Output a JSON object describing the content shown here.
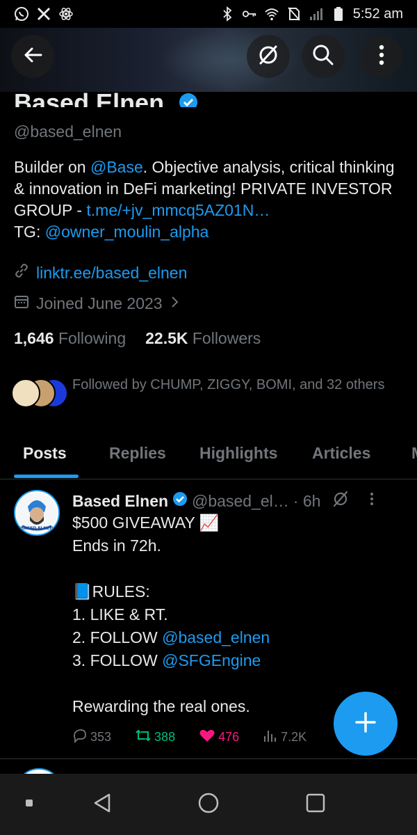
{
  "status_bar": {
    "time": "5:52 am",
    "left_icons": [
      "whatsapp-icon",
      "x-logo-icon",
      "atom-icon"
    ],
    "right_icons": [
      "bluetooth-icon",
      "key-icon",
      "wifi-icon",
      "no-sim-icon",
      "signal-icon",
      "battery-icon"
    ]
  },
  "header": {
    "back_icon": "arrow-left-icon",
    "grok_icon": "grok-icon",
    "search_icon": "search-icon",
    "more_icon": "more-vertical-icon"
  },
  "profile": {
    "name": "Based Elnen",
    "verified": true,
    "handle": "@based_elnen",
    "bio_parts": {
      "p1": "Builder on ",
      "mention_base": "@Base",
      "p2": ". Objective analysis, critical thinking & innovation in DeFi marketing! PRIVATE INVESTOR GROUP - ",
      "tg_link": "t.me/+jv_mmcq5AZ01N…",
      "p3": "TG: ",
      "tg_mention": "@owner_moulin_alpha"
    },
    "website": "linktr.ee/based_elnen",
    "joined": "Joined June 2023",
    "following_count": "1,646",
    "following_label": "Following",
    "followers_count": "22.5K",
    "followers_label": "Followers",
    "followed_by": "Followed by CHUMP, ZIGGY, BOMI, and 32 others"
  },
  "tabs": [
    {
      "label": "Posts",
      "active": true
    },
    {
      "label": "Replies",
      "active": false
    },
    {
      "label": "Highlights",
      "active": false
    },
    {
      "label": "Articles",
      "active": false
    },
    {
      "label": "M",
      "active": false
    }
  ],
  "post": {
    "author": "Based Elnen",
    "handle": "@based_el…",
    "time": "· 6h",
    "avatar_text": "BASED ELNEN",
    "line1": "$500 GIVEAWAY 📈",
    "line2": "Ends in 72h.",
    "line3": "📘RULES:",
    "line4": "1. LIKE & RT.",
    "line5_prefix": "2. FOLLOW ",
    "line5_mention": "@based_elnen",
    "line6_prefix": "3. FOLLOW ",
    "line6_mention": "@SFGEngine",
    "line7": "Rewarding the real ones.",
    "replies": "353",
    "reposts": "388",
    "likes": "476",
    "views": "7.2K"
  },
  "colors": {
    "accent": "#1d9bf0",
    "repost_green": "#00ba7c",
    "like_pink": "#f91880",
    "muted": "#71767b"
  },
  "fab": {
    "icon": "plus-icon"
  },
  "nav_bar": {
    "icons": [
      "recent-apps-dot-icon",
      "back-triangle-icon",
      "home-circle-icon",
      "overview-square-icon"
    ]
  }
}
